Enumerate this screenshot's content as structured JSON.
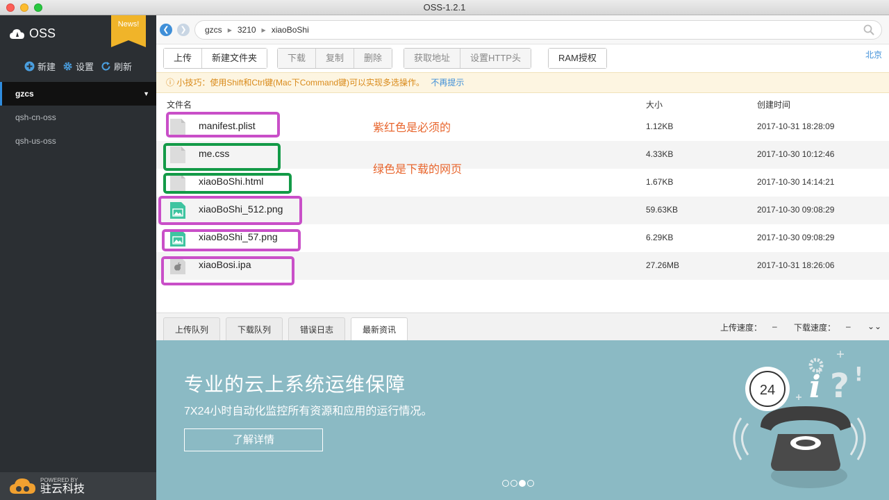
{
  "window": {
    "title": "OSS-1.2.1"
  },
  "sidebar": {
    "logo_text": "OSS",
    "news_badge": "News!",
    "actions": [
      {
        "label": "新建",
        "icon": "plus-circle-icon"
      },
      {
        "label": "设置",
        "icon": "gear-icon"
      },
      {
        "label": "刷新",
        "icon": "refresh-icon"
      }
    ],
    "buckets": [
      {
        "name": "gzcs",
        "active": true
      },
      {
        "name": "qsh-cn-oss",
        "active": false
      },
      {
        "name": "qsh-us-oss",
        "active": false
      }
    ],
    "powered_by": {
      "small": "POWERED BY",
      "brand": "驻云科技"
    }
  },
  "address": {
    "crumbs": [
      "gzcs",
      "3210",
      "xiaoBoShi"
    ]
  },
  "toolbar": {
    "upload": "上传",
    "new_folder": "新建文件夹",
    "download": "下载",
    "copy": "复制",
    "delete": "删除",
    "get_address": "获取地址",
    "set_http_header": "设置HTTP头",
    "ram": "RAM授权",
    "region": "北京"
  },
  "tip": {
    "text": "小技巧：使用Shift和Ctrl键(Mac下Command键)可以实现多选操作。",
    "link": "不再提示"
  },
  "table": {
    "headers": {
      "name": "文件名",
      "size": "大小",
      "created": "创建时间"
    },
    "rows": [
      {
        "name": "manifest.plist",
        "size": "1.12KB",
        "created": "2017-10-31 18:28:09",
        "icon": "file-icon"
      },
      {
        "name": "me.css",
        "size": "4.33KB",
        "created": "2017-10-30 10:12:46",
        "icon": "file-icon"
      },
      {
        "name": "xiaoBoShi.html",
        "size": "1.67KB",
        "created": "2017-10-30 14:14:21",
        "icon": "file-icon"
      },
      {
        "name": "xiaoBoShi_512.png",
        "size": "59.63KB",
        "created": "2017-10-30 09:08:29",
        "icon": "image-file-icon"
      },
      {
        "name": "xiaoBoShi_57.png",
        "size": "6.29KB",
        "created": "2017-10-30 09:08:29",
        "icon": "image-file-icon"
      },
      {
        "name": "xiaoBosi.ipa",
        "size": "27.26MB",
        "created": "2017-10-31 18:26:06",
        "icon": "apple-file-icon"
      }
    ]
  },
  "annotations": {
    "purple_note": "紫红色是必须的",
    "green_note": "绿色是下载的网页",
    "colors": {
      "purple": "#c94fc8",
      "green": "#139a47",
      "note": "#e8662e"
    }
  },
  "bottom_tabs": {
    "tabs": [
      "上传队列",
      "下载队列",
      "错误日志",
      "最新资讯"
    ],
    "active_index": 3,
    "upload_speed_label": "上传速度：",
    "upload_speed_value": "–",
    "download_speed_label": "下载速度：",
    "download_speed_value": "–"
  },
  "promo": {
    "title": "专业的云上系统运维保障",
    "subtitle": "7X24小时自动化监控所有资源和应用的运行情况。",
    "button": "了解详情",
    "badge_number": "24",
    "slide_count": 4,
    "active_slide": 2
  }
}
